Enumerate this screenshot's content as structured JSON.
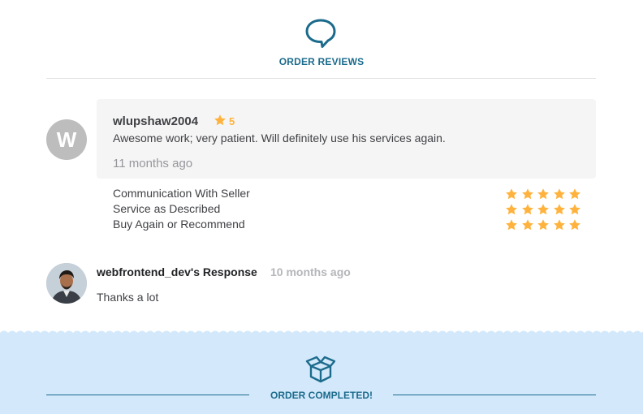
{
  "header": {
    "icon": "chat-bubble-icon",
    "title": "ORDER REVIEWS"
  },
  "review": {
    "avatar_letter": "W",
    "reviewer": "wlupshaw2004",
    "rating": "5",
    "text": "Awesome work; very patient. Will definitely use his services again.",
    "time": "11 months ago",
    "criteria": [
      {
        "label": "Communication With Seller",
        "stars": 5
      },
      {
        "label": "Service as Described",
        "stars": 5
      },
      {
        "label": "Buy Again or Recommend",
        "stars": 5
      }
    ]
  },
  "response": {
    "author": "webfrontend_dev's Response",
    "time": "10 months ago",
    "text": "Thanks a lot"
  },
  "completed": {
    "icon": "open-box-icon",
    "title": "ORDER COMPLETED!"
  },
  "colors": {
    "accent": "#1c6b8c",
    "star": "#ffb33e",
    "completed_bg": "#d3e9fb"
  }
}
